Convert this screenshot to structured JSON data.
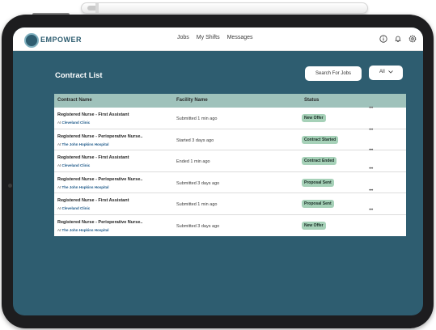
{
  "nav": {
    "brand": "EMPOWER",
    "links": [
      "Jobs",
      "My Shifts",
      "Messages"
    ],
    "icons": [
      "info-icon",
      "bell-icon",
      "gear-icon"
    ]
  },
  "page": {
    "title": "Contract List",
    "search_button": "Search For Jobs",
    "filter_button": "All"
  },
  "table": {
    "columns": [
      "Contract Name",
      "Facility Name",
      "Status"
    ],
    "rows": [
      {
        "name": "Registered Nurse - First Assistant",
        "at": "At",
        "facility": "Cleveland Clinic",
        "date": "Submitted 1 min ago",
        "status": "New Offer"
      },
      {
        "name": "Registered Nurse - Perioperative Nurse..",
        "at": "At",
        "facility": "The John Hopkins Hospital",
        "date": "Started 3 days ago",
        "status": "Contract Started"
      },
      {
        "name": "Registered Nurse - First Assistant",
        "at": "At",
        "facility": "Cleveland Clinic",
        "date": "Ended 1 min ago",
        "status": "Contract Ended"
      },
      {
        "name": "Registered Nurse - Perioperative Nurse..",
        "at": "At",
        "facility": "The John Hopkins Hospital",
        "date": "Submitted 3 days ago",
        "status": "Proposal Sent"
      },
      {
        "name": "Registered Nurse - First Assistant",
        "at": "At",
        "facility": "Cleveland Clinic",
        "date": "Submitted 1 min ago",
        "status": "Proposal Sent"
      },
      {
        "name": "Registered Nurse - Perioperative Nurse..",
        "at": "At",
        "facility": "The John Hopkins Hospital",
        "date": "Submitted 3 days ago",
        "status": "New Offer"
      }
    ],
    "more_label": "•••"
  },
  "colors": {
    "screen_bg": "#2e5d70",
    "header_bg": "#9fc2bb",
    "badge_bg": "#a6d1b8",
    "facility_text": "#1e5a8a"
  }
}
